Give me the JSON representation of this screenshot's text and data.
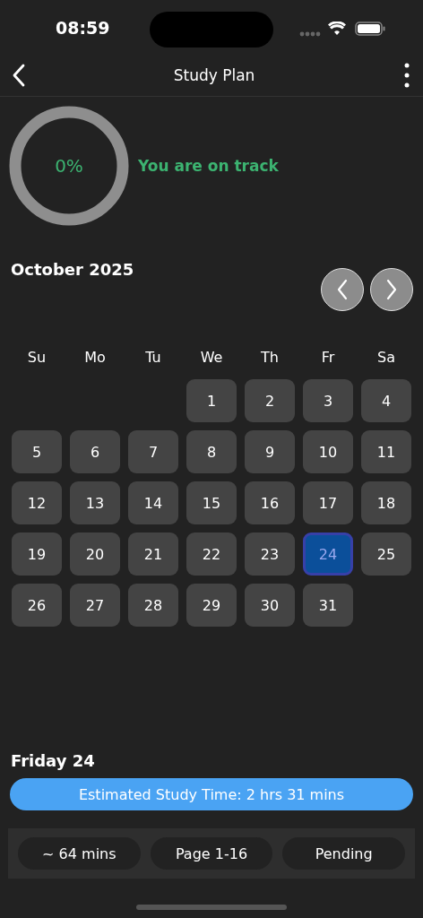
{
  "status_bar": {
    "time": "08:59"
  },
  "nav": {
    "title": "Study Plan"
  },
  "progress": {
    "level": 0,
    "percent": "0%",
    "message": "You are on track"
  },
  "calendar": {
    "month": "October 2025",
    "weekdays": [
      "Su",
      "Mo",
      "Tu",
      "We",
      "Th",
      "Fr",
      "Sa"
    ],
    "cells": [
      {
        "kind": "empty"
      },
      {
        "kind": "empty"
      },
      {
        "kind": "empty"
      },
      {
        "kind": "day",
        "label": "1",
        "selected": false
      },
      {
        "kind": "day",
        "label": "2",
        "selected": false
      },
      {
        "kind": "day",
        "label": "3",
        "selected": false
      },
      {
        "kind": "day",
        "label": "4",
        "selected": false
      },
      {
        "kind": "day",
        "label": "5",
        "selected": false
      },
      {
        "kind": "day",
        "label": "6",
        "selected": false
      },
      {
        "kind": "day",
        "label": "7",
        "selected": false
      },
      {
        "kind": "day",
        "label": "8",
        "selected": false
      },
      {
        "kind": "day",
        "label": "9",
        "selected": false
      },
      {
        "kind": "day",
        "label": "10",
        "selected": false
      },
      {
        "kind": "day",
        "label": "11",
        "selected": false
      },
      {
        "kind": "day",
        "label": "12",
        "selected": false
      },
      {
        "kind": "day",
        "label": "13",
        "selected": false
      },
      {
        "kind": "day",
        "label": "14",
        "selected": false
      },
      {
        "kind": "day",
        "label": "15",
        "selected": false
      },
      {
        "kind": "day",
        "label": "16",
        "selected": false
      },
      {
        "kind": "day",
        "label": "17",
        "selected": false
      },
      {
        "kind": "day",
        "label": "18",
        "selected": false
      },
      {
        "kind": "day",
        "label": "19",
        "selected": false
      },
      {
        "kind": "day",
        "label": "20",
        "selected": false
      },
      {
        "kind": "day",
        "label": "21",
        "selected": false
      },
      {
        "kind": "day",
        "label": "22",
        "selected": false
      },
      {
        "kind": "day",
        "label": "23",
        "selected": false
      },
      {
        "kind": "day",
        "label": "24",
        "selected": true
      },
      {
        "kind": "day",
        "label": "25",
        "selected": false
      },
      {
        "kind": "day",
        "label": "26",
        "selected": false
      },
      {
        "kind": "day",
        "label": "27",
        "selected": false
      },
      {
        "kind": "day",
        "label": "28",
        "selected": false
      },
      {
        "kind": "day",
        "label": "29",
        "selected": false
      },
      {
        "kind": "day",
        "label": "30",
        "selected": false
      },
      {
        "kind": "day",
        "label": "31",
        "selected": false
      }
    ]
  },
  "day_detail": {
    "title": "Friday 24",
    "estimate": "Estimated Study Time: 2 hrs 31 mins",
    "chips": [
      "~ 64 mins",
      "Page 1-16",
      "Pending"
    ]
  }
}
